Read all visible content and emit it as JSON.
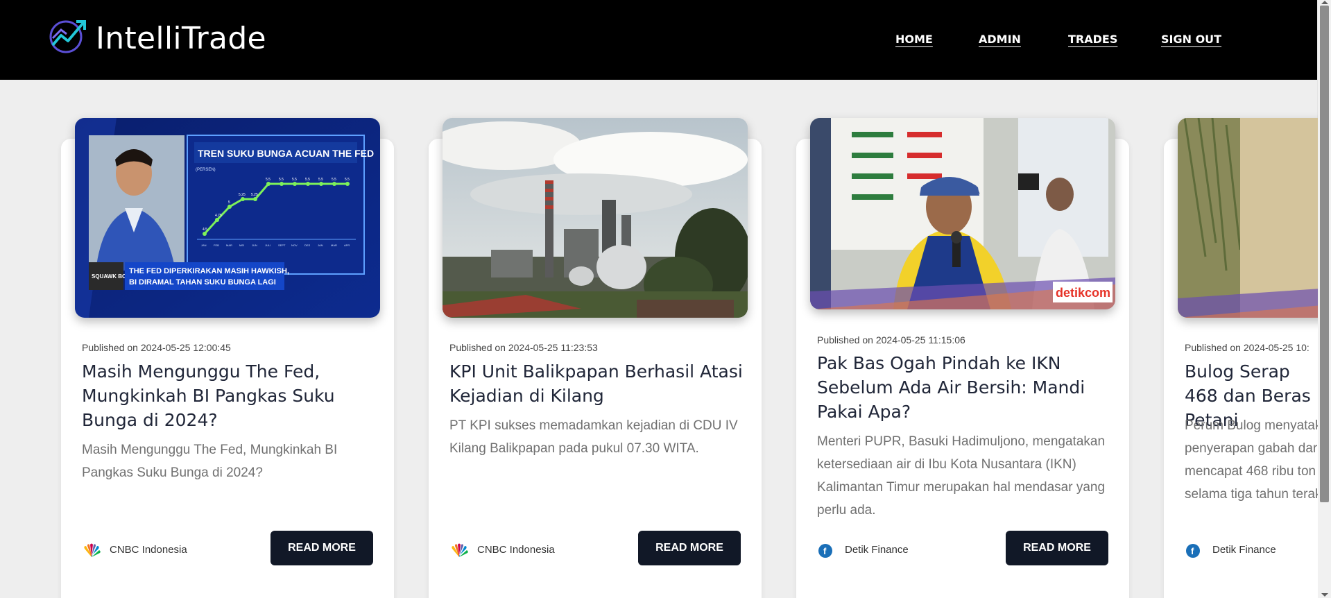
{
  "header": {
    "brand": "IntelliTrade",
    "nav": [
      {
        "label": "HOME"
      },
      {
        "label": "ADMIN"
      },
      {
        "label": "TRADES"
      },
      {
        "label": "SIGN OUT"
      }
    ]
  },
  "articles": [
    {
      "published": "Published on 2024-05-25 12:00:45",
      "title": "Masih Mengunggu The Fed, Mungkinkah BI Pangkas Suku Bunga di 2024?",
      "description": "Masih Mengunggu The Fed, Mungkinkah BI Pangkas Suku Bunga di 2024?",
      "source": "CNBC Indonesia",
      "source_icon": "cnbc-peacock-icon",
      "read_more": "READ MORE",
      "image_text": {
        "headline": "TREN SUKU BUNGA ACUAN THE FED",
        "unit": "(PERSEN)",
        "ticker_brand": "SQUAWK BOX",
        "ticker_line1": "THE FED DIPERKIRAKAN MASIH HAWKISH,",
        "ticker_line2": "BI DIRAMAL TAHAN SUKU BUNGA LAGI"
      }
    },
    {
      "published": "Published on 2024-05-25 11:23:53",
      "title": "KPI Unit Balikpapan Berhasil Atasi Kejadian di Kilang",
      "description": "PT KPI sukses memadamkan kejadian di CDU IV Kilang Balikpapan pada pukul 07.30 WITA.",
      "source": "CNBC Indonesia",
      "source_icon": "cnbc-peacock-icon",
      "read_more": "READ MORE"
    },
    {
      "published": "Published on 2024-05-25 11:15:06",
      "title": "Pak Bas Ogah Pindah ke IKN Sebelum Ada Air Bersih: Mandi Pakai Apa?",
      "description": "Menteri PUPR, Basuki Hadimuljono, mengatakan ketersediaan air di Ibu Kota Nusantara (IKN) Kalimantan Timur merupakan hal mendasar yang perlu ada.",
      "source": "Detik Finance",
      "source_icon": "detik-finance-icon",
      "read_more": "READ MORE",
      "image_text": {
        "watermark": "detikcom"
      }
    },
    {
      "published": "Published on 2024-05-25 10:",
      "title": "Bulog Serap 468 dan Beras Petani",
      "description": "Perum Bulog menyatak penyerapan gabah dar mencapat 468 ribu ton selama tiga tahun terak",
      "source": "Detik Finance",
      "source_icon": "detik-finance-icon"
    }
  ]
}
